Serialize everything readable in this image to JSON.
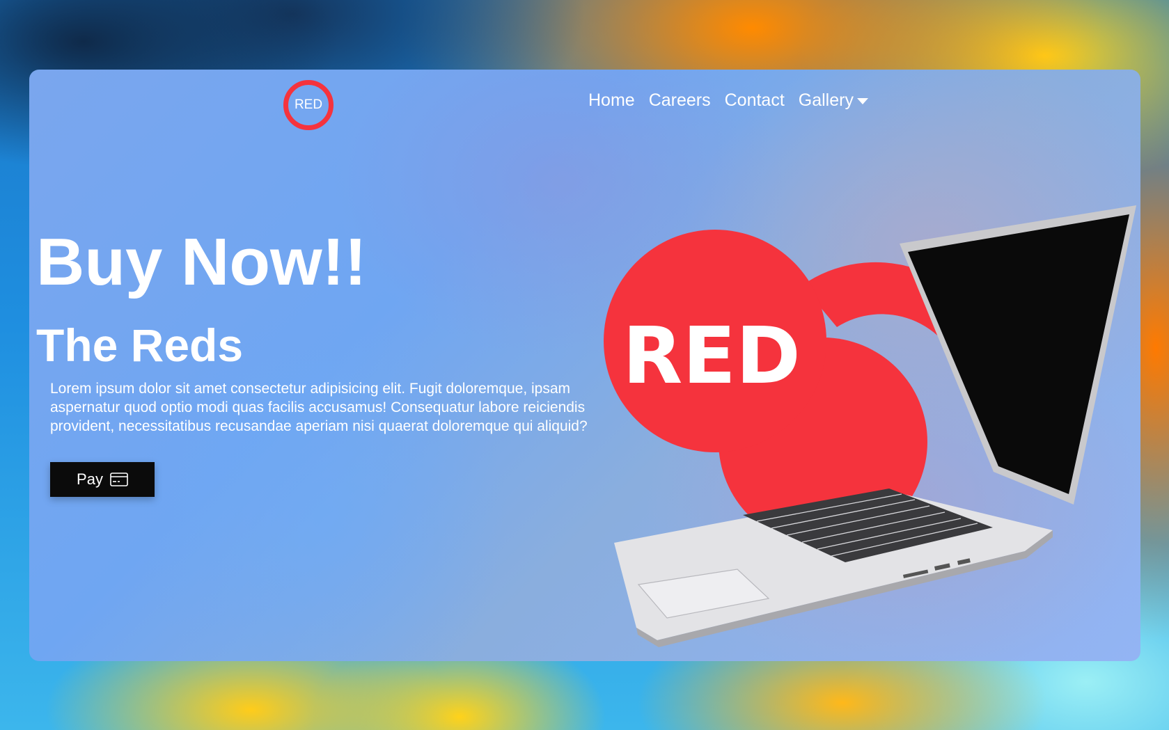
{
  "brand": {
    "logo_text": "RED",
    "accent": "#f5333d"
  },
  "nav": {
    "items": [
      {
        "label": "Home"
      },
      {
        "label": "Careers"
      },
      {
        "label": "Contact"
      },
      {
        "label": "Gallery",
        "has_dropdown": true
      }
    ]
  },
  "hero": {
    "headline": "Buy Now!!",
    "subheadline": "The Reds",
    "description": "Lorem ipsum dolor sit amet consectetur adipisicing elit. Fugit doloremque, ipsam aspernatur quod optio modi quas facilis accusamus! Consequatur labore reiciendis provident, necessitatibus recusandae aperiam nisi quaerat doloremque qui aliquid?",
    "pay_label": "Pay",
    "pay_icon": "credit-card-icon",
    "illustration_badge_text": "RED",
    "illustration": "laptop"
  }
}
